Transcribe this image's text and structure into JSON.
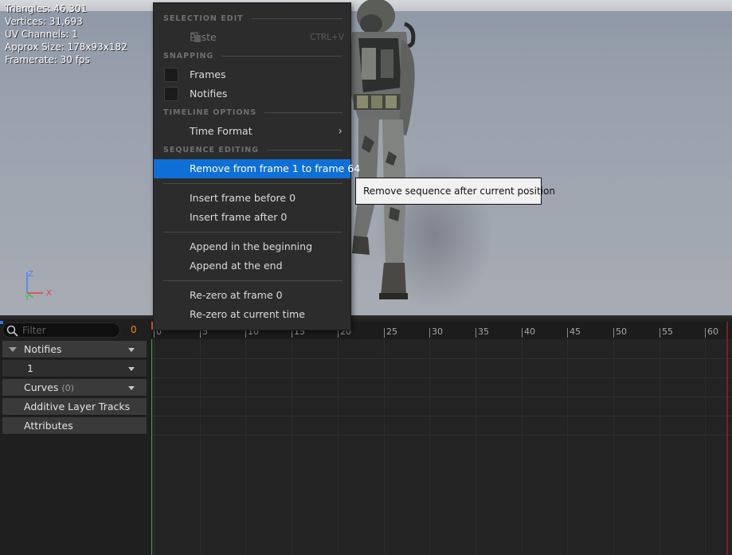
{
  "viewport": {
    "stats": {
      "triangles": "Triangles: 46,301",
      "vertices": "Vertices: 31,693",
      "uv_channels": "UV Channels: 1",
      "approx_size": "Approx Size: 178x93x182",
      "framerate": "Framerate: 30 fps"
    },
    "axis": {
      "z": "Z",
      "y": "Y",
      "x": "X"
    }
  },
  "context_menu": {
    "sections": {
      "selection_edit": "SELECTION EDIT",
      "snapping": "SNAPPING",
      "timeline_options": "TIMELINE OPTIONS",
      "sequence_editing": "SEQUENCE EDITING"
    },
    "paste": {
      "label": "Paste",
      "shortcut": "CTRL+V",
      "enabled": false
    },
    "snap_frames": {
      "label": "Frames",
      "checked": false
    },
    "snap_notifies": {
      "label": "Notifies",
      "checked": false
    },
    "time_format": {
      "label": "Time Format"
    },
    "remove_range": {
      "label": "Remove from frame 1 to frame 64"
    },
    "insert_before": {
      "label": "Insert frame before 0"
    },
    "insert_after": {
      "label": "Insert frame after 0"
    },
    "append_begin": {
      "label": "Append in the beginning"
    },
    "append_end": {
      "label": "Append at the end"
    },
    "rezero_frame": {
      "label": "Re-zero at frame 0"
    },
    "rezero_current": {
      "label": "Re-zero at current time"
    }
  },
  "tooltip": {
    "text": "Remove sequence after current position"
  },
  "track_panel": {
    "filter_placeholder": "Filter",
    "filter_count": "0",
    "tracks": {
      "notifies": "Notifies",
      "notify_track_1": "1",
      "curves": "Curves",
      "curves_count": "(0)",
      "additive": "Additive Layer Tracks",
      "attributes": "Attributes"
    }
  },
  "timeline": {
    "ruler_labels": [
      "0",
      "5",
      "10",
      "15",
      "20",
      "25",
      "30",
      "35",
      "40",
      "45",
      "50",
      "55",
      "60"
    ]
  },
  "colors": {
    "menu_highlight": "#0e70d6",
    "filter_count": "#e88a1e",
    "axis_x": "#e04040",
    "axis_y": "#3fbf3f",
    "axis_z": "#4a7bff"
  }
}
